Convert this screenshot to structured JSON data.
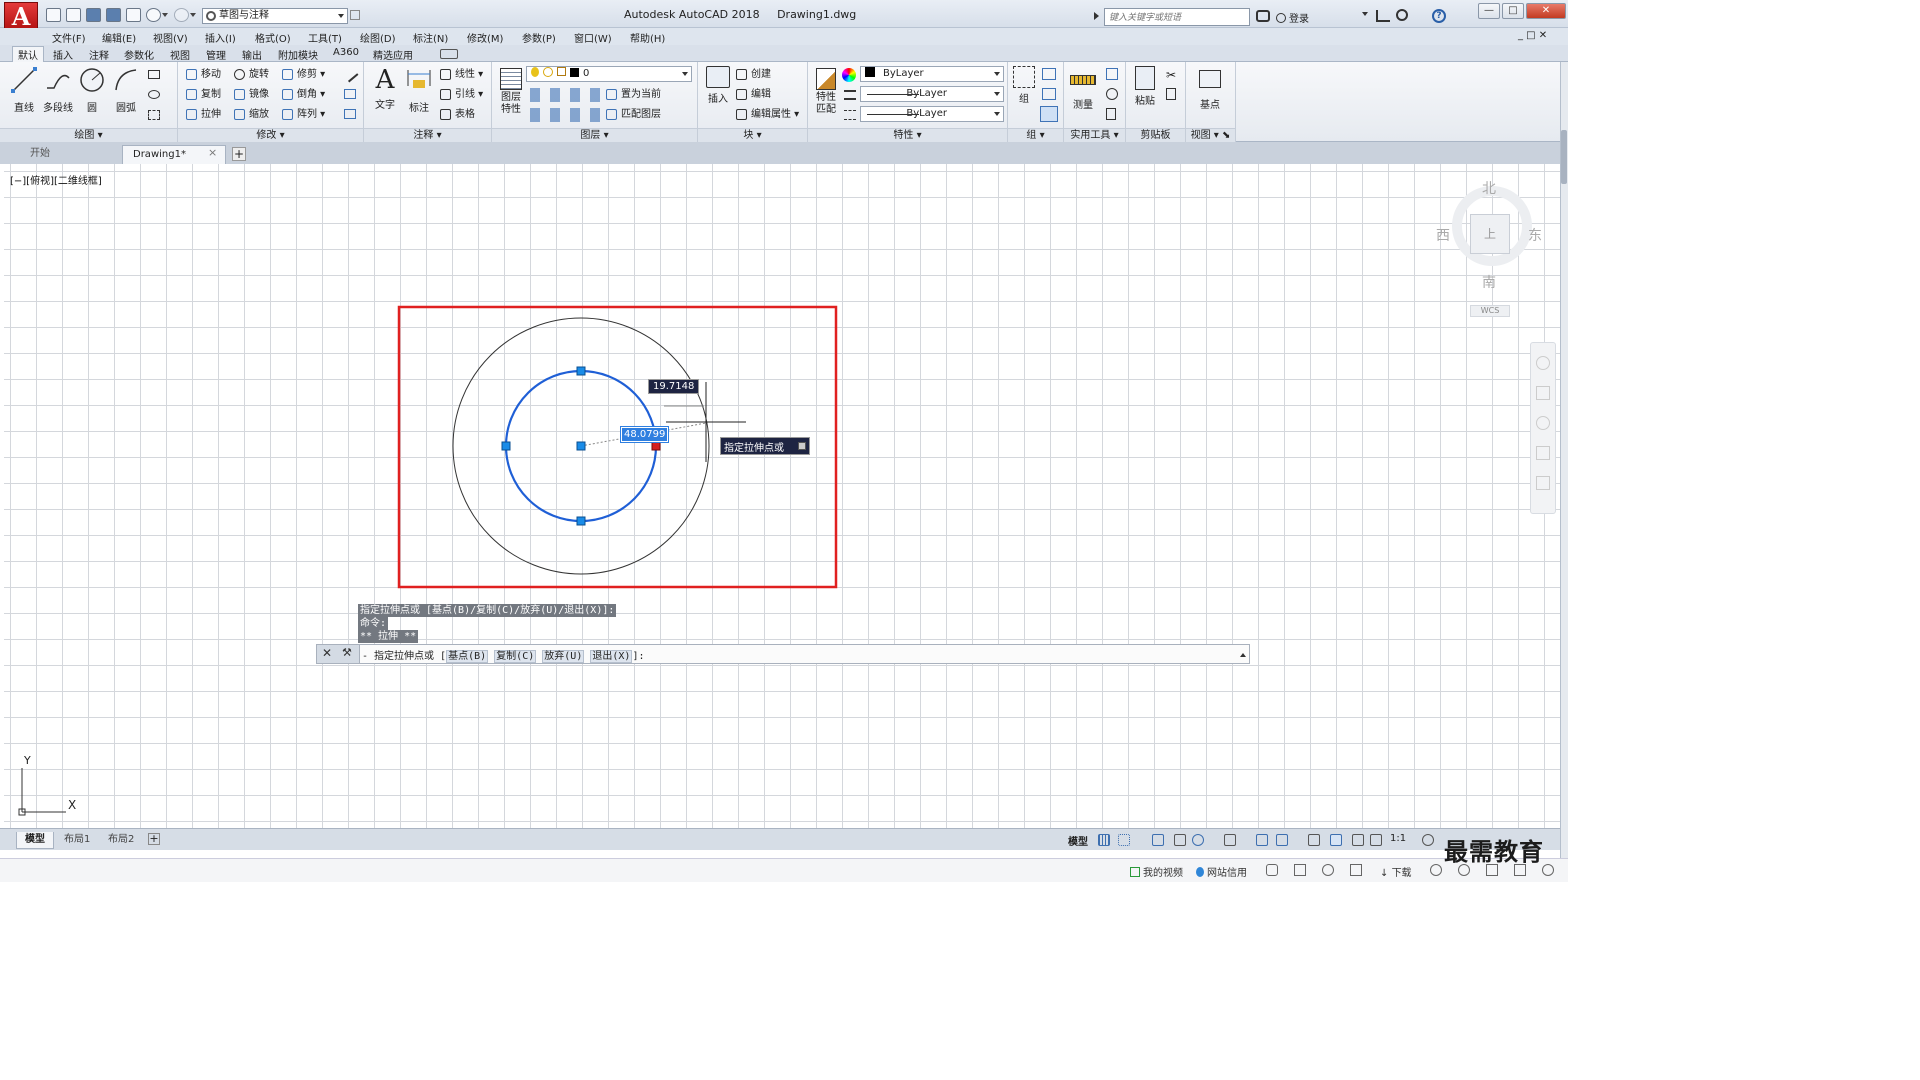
{
  "app": {
    "title": "Autodesk AutoCAD 2018",
    "document": "Drawing1.dwg",
    "app_button_letter": "A",
    "workspace": "草图与注释",
    "search_placeholder": "键入关键字或短语",
    "signin": "登录"
  },
  "menus": [
    "文件(F)",
    "编辑(E)",
    "视图(V)",
    "插入(I)",
    "格式(O)",
    "工具(T)",
    "绘图(D)",
    "标注(N)",
    "修改(M)",
    "参数(P)",
    "窗口(W)",
    "帮助(H)"
  ],
  "ribbon_tabs": [
    "默认",
    "插入",
    "注释",
    "参数化",
    "视图",
    "管理",
    "输出",
    "附加模块",
    "A360",
    "精选应用"
  ],
  "ribbon": {
    "draw": {
      "title": "绘图",
      "line": "直线",
      "polyline": "多段线",
      "circle": "圆",
      "arc": "圆弧"
    },
    "modify": {
      "title": "修改",
      "move": "移动",
      "rotate": "旋转",
      "trim": "修剪",
      "copy": "复制",
      "mirror": "镜像",
      "fillet": "倒角",
      "stretch": "拉伸",
      "scale": "缩放",
      "array": "阵列"
    },
    "annotation": {
      "title": "注释",
      "text": "文字",
      "dimension": "标注",
      "linear": "线性",
      "leader": "引线",
      "table": "表格"
    },
    "layers": {
      "title": "图层",
      "layer_props": "图层特性",
      "current_layer": "0",
      "make_current": "置为当前",
      "match_layer": "匹配图层"
    },
    "block": {
      "title": "块",
      "insert": "插入",
      "create": "创建",
      "edit": "编辑",
      "edit_attr": "编辑属性"
    },
    "properties": {
      "title": "特性",
      "match": "特性匹配",
      "color": "ByLayer",
      "linetype": "ByLayer",
      "lineweight": "ByLayer"
    },
    "groups": {
      "title": "组",
      "group": "组"
    },
    "utilities": {
      "title": "实用工具",
      "measure": "测量"
    },
    "clipboard": {
      "title": "剪贴板",
      "paste": "粘贴"
    },
    "view": {
      "title": "视图",
      "base": "基点"
    }
  },
  "doc_tabs": {
    "start": "开始",
    "drawing": "Drawing1*",
    "close": "×",
    "add": "+"
  },
  "viewport": {
    "label": "[−][俯视][二维线框]",
    "dim_radius": "19.7148",
    "dim_distance": "48.0799",
    "tooltip": "指定拉伸点或"
  },
  "viewcube": {
    "north": "北",
    "south": "南",
    "east": "东",
    "west": "西",
    "top": "上",
    "wcs": "WCS"
  },
  "ucs": {
    "x": "X",
    "y": "Y"
  },
  "command": {
    "history": [
      "指定拉伸点或 [基点(B)/复制(C)/放弃(U)/退出(X)]:",
      "命令:",
      "** 拉伸 **"
    ],
    "prompt_prefix": "- 指定拉伸点或 [",
    "options": [
      "基点(B)",
      "复制(C)",
      "放弃(U)",
      "退出(X)"
    ],
    "prompt_suffix": "]:"
  },
  "layout_tabs": [
    "模型",
    "布局1",
    "布局2"
  ],
  "status": {
    "model": "模型",
    "scale": "1:1"
  },
  "taskbar": {
    "my_videos": "我的视频",
    "site_credit": "网站信用",
    "download": "下载"
  },
  "watermark": "最需教育",
  "colors": {
    "selected_circle": "#1f5fd6",
    "highlight_box": "#e02020",
    "grip": "#1a8ce8",
    "hot_grip": "#d42020"
  }
}
